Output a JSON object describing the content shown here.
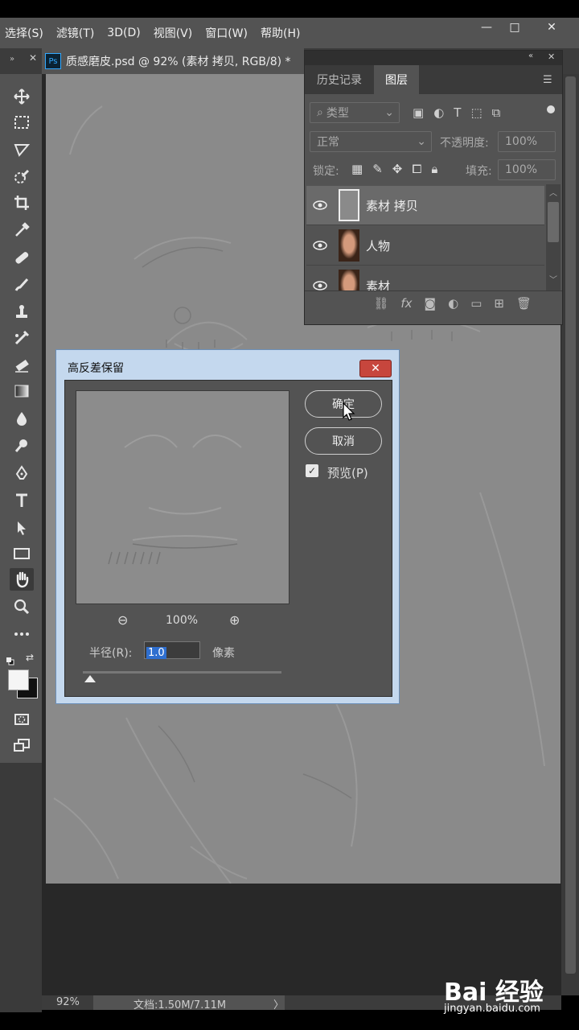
{
  "menubar": {
    "items": [
      "选择(S)",
      "滤镜(T)",
      "3D(D)",
      "视图(V)",
      "窗口(W)",
      "帮助(H)"
    ],
    "window_controls": [
      "—",
      "□",
      "✕"
    ]
  },
  "document": {
    "tab_title": "质感磨皮.psd @ 92% (素材 拷贝, RGB/8) *",
    "ps_badge": "Ps"
  },
  "layers_panel": {
    "tabs": [
      "历史记录",
      "图层"
    ],
    "active_tab": "图层",
    "filter_placeholder": "类型",
    "blend_mode": "正常",
    "opacity_label": "不透明度:",
    "opacity_value": "100%",
    "lock_label": "锁定:",
    "fill_label": "填充:",
    "fill_value": "100%",
    "layers": [
      {
        "name": "素材 拷贝",
        "selected": true
      },
      {
        "name": "人物",
        "selected": false
      },
      {
        "name": "素材",
        "selected": false
      }
    ]
  },
  "dialog": {
    "title": "高反差保留",
    "ok_label": "确定",
    "cancel_label": "取消",
    "preview_label": "预览(P)",
    "preview_checked": true,
    "zoom_value": "100%",
    "radius_label": "半径(R):",
    "radius_value": "1.0",
    "radius_unit": "像素"
  },
  "statusbar": {
    "zoom": "92%",
    "doc_info": "文档:1.50M/7.11M",
    "arrow": "〉"
  },
  "watermark": {
    "text": "Bai 经验",
    "url": "jingyan.baidu.com"
  },
  "colors": {
    "menu_bg": "#535353",
    "canvas_gray": "#8a8a8a",
    "dialog_frame": "#c4d8ee",
    "close_red": "#c7463d",
    "selection_blue": "#2f6fcf"
  }
}
